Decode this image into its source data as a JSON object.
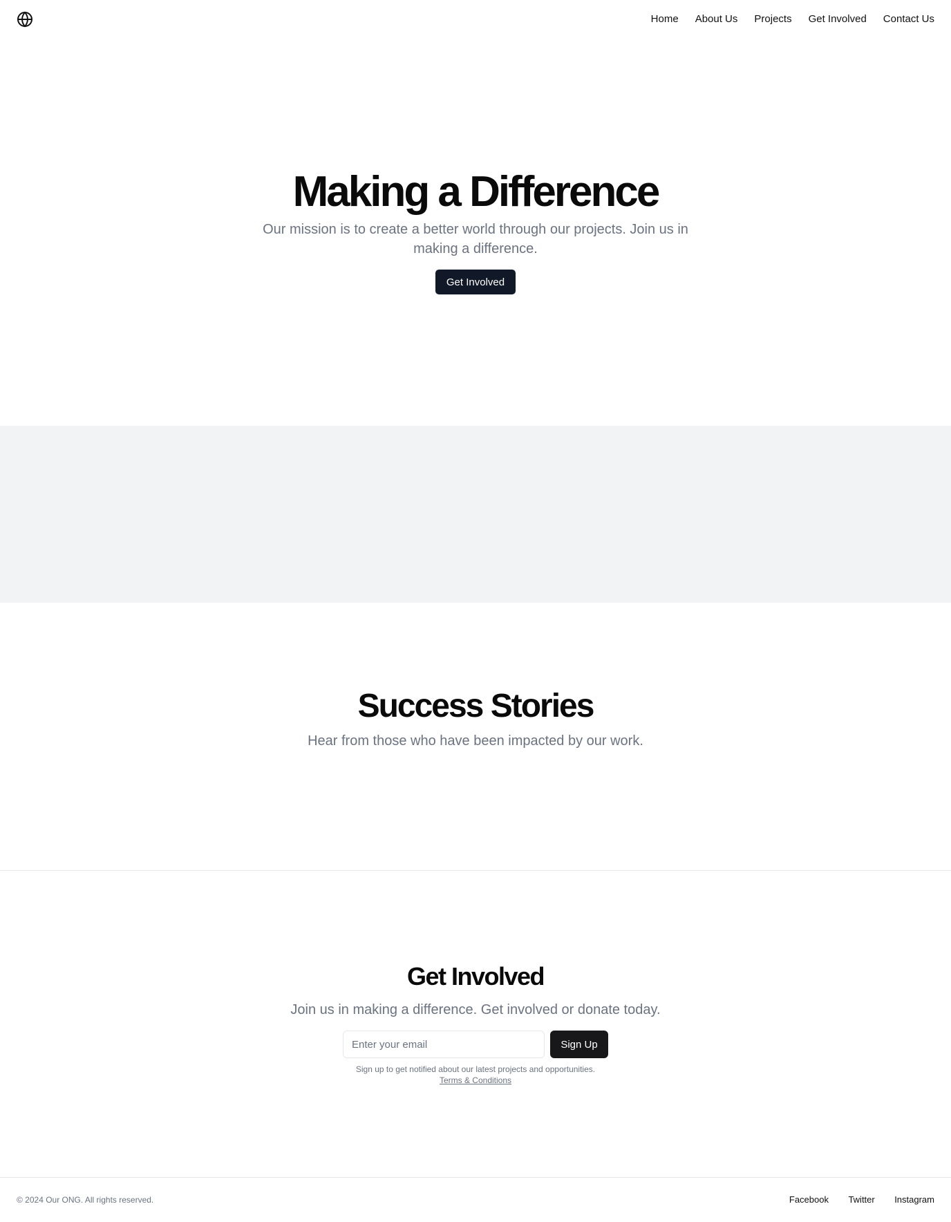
{
  "header": {
    "logo_icon": "globe-icon",
    "nav": [
      {
        "label": "Home"
      },
      {
        "label": "About Us"
      },
      {
        "label": "Projects"
      },
      {
        "label": "Get Involved"
      },
      {
        "label": "Contact Us"
      }
    ]
  },
  "hero": {
    "title": "Making a Difference",
    "subtitle": "Our mission is to create a better world through our projects. Join us in making a difference.",
    "cta_label": "Get Involved"
  },
  "stories": {
    "title": "Success Stories",
    "subtitle": "Hear from those who have been impacted by our work."
  },
  "involved": {
    "title": "Get Involved",
    "lead": "Join us in making a difference. Get involved or donate today.",
    "email_placeholder": "Enter your email",
    "email_value": "",
    "signup_label": "Sign Up",
    "fineprint": "Sign up to get notified about our latest projects and opportunities.",
    "terms_label": "Terms & Conditions"
  },
  "footer": {
    "copyright": "© 2024 Our ONG. All rights reserved.",
    "links": [
      {
        "label": "Facebook"
      },
      {
        "label": "Twitter"
      },
      {
        "label": "Instagram"
      }
    ]
  },
  "colors": {
    "primary_button": "#111827",
    "signup_button": "#18181b",
    "muted_text": "#6b7280",
    "band_background": "#f2f3f5"
  }
}
